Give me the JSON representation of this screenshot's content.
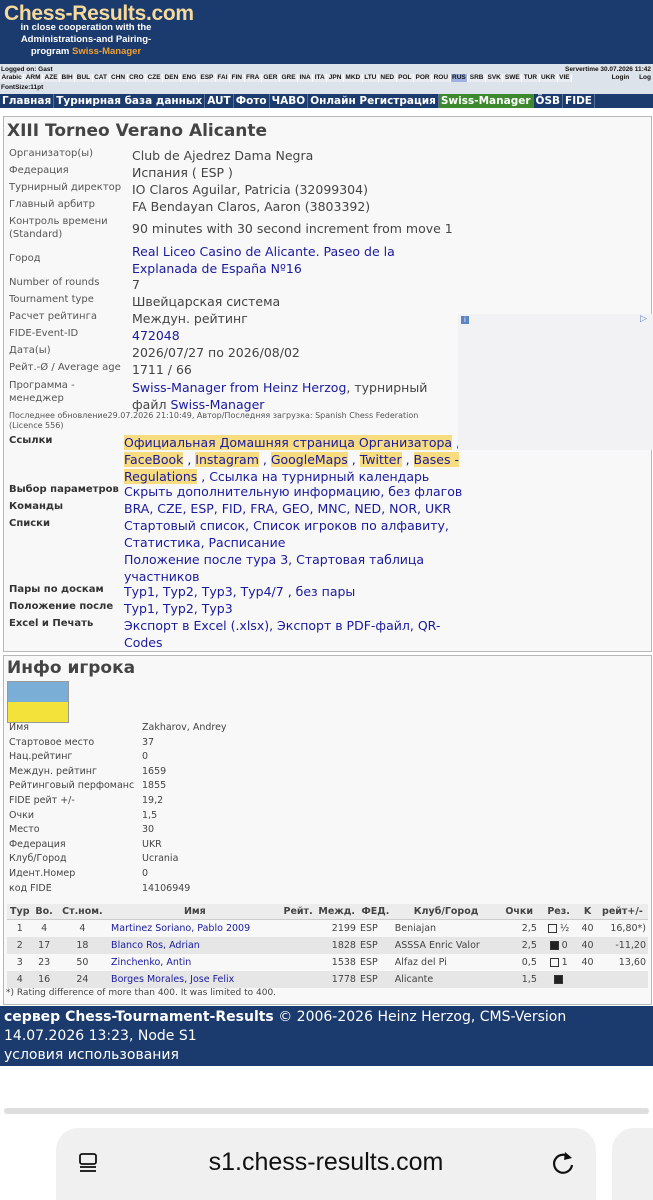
{
  "header": {
    "brand": "Chess-Results.com",
    "tagline_lines": [
      "in close cooperation with the",
      "Administrations-and Pairing-"
    ],
    "tagline_prefix": "program ",
    "tagline_highlight": "Swiss-Manager"
  },
  "status": {
    "logged_on": "Logged on: Gast",
    "servertime": "Servertime 30.07.2026 11:42",
    "languages": [
      "Arabic",
      "ARM",
      "AZE",
      "BIH",
      "BUL",
      "CAT",
      "CHN",
      "CRO",
      "CZE",
      "DEN",
      "ENG",
      "ESP",
      "FAI",
      "FIN",
      "FRA",
      "GER",
      "GRE",
      "INA",
      "ITA",
      "JPN",
      "MKD",
      "LTU",
      "NED",
      "POL",
      "POR",
      "ROU",
      "RUS",
      "SRB",
      "SVK",
      "SWE",
      "TUR",
      "UKR",
      "VIE"
    ],
    "active_language": "RUS",
    "login": "Login",
    "log": "Log",
    "fontsize": "FontSize:11pt"
  },
  "nav": [
    "Главная",
    "Турнирная база данных",
    "AUT",
    "Фото",
    "ЧАВО",
    "Онлайн Регистрация",
    "Swiss-Manager",
    "ÖSB",
    "FIDE"
  ],
  "tournament": {
    "title": "XIII Torneo Verano Alicante",
    "organizer_label": "Организатор(ы)",
    "organizer": "Club de Ajedrez Dama Negra",
    "federation_label": "Федерация",
    "federation": "Испания ( ESP )",
    "director_label": "Турнирный директор",
    "director": "IO Claros Aguilar, Patricia (32099304)",
    "arbiter_label": "Главный арбитр",
    "arbiter": "FA Bendayan Claros, Aaron (3803392)",
    "time_label_1": "Контроль времени",
    "time_label_2": "(Standard)",
    "time_control": "90 minutes with 30 second increment from move 1",
    "city_label": "Город",
    "city": "Real Liceo Casino de Alicante. Paseo de la Explanada de España Nº16",
    "rounds_label": "Number of rounds",
    "rounds": "7",
    "type_label": "Tournament type",
    "type": "Швейцарская система",
    "rating_label": "Расчет рейтинга",
    "rating": "Междун. рейтинг",
    "fide_event_label": "FIDE-Event-ID",
    "fide_event": "472048",
    "dates_label": "Дата(ы)",
    "dates": "2026/07/27 по 2026/08/02",
    "avg_label": "Рейт.-Ø / Average age",
    "avg": "1711 / 66",
    "program_label_1": "Программа -",
    "program_label_2": "менеджер",
    "program_link1": "Swiss-Manager from Heinz Herzog",
    "program_sep": ", турнирный файл ",
    "program_link2": "Swiss-Manager",
    "updated": "Последнее обновление29.07.2026 21:10:49, Автор/Последняя загрузка: Spanish Chess Federation (Licence 556)",
    "links_label": "Ссылки",
    "link_home": "Официальная Домашняя страница Организатора",
    "link_facebook": "FaceBook",
    "link_instagram": "Instagram",
    "link_maps": "GoogleMaps",
    "link_twitter": "Twitter",
    "link_bases": "Bases - Regulations",
    "link_calendar": "Ссылка на турнирный календарь",
    "params_label": "Выбор параметров",
    "params_hide": "Скрыть дополнительную информацию",
    "params_noflags": "без флагов",
    "teams_label": "Команды",
    "teams": [
      "BRA",
      "CZE",
      "ESP",
      "FID",
      "FRA",
      "GEO",
      "MNC",
      "NED",
      "NOR",
      "UKR"
    ],
    "lists_label": "Списки",
    "list_start": "Стартовый список",
    "list_alpha": "Список игроков по алфавиту",
    "list_stats": "Статистика",
    "list_schedule": "Расписание",
    "list_after": "Положение после тура 3",
    "list_crosstable": "Стартовая таблица участников",
    "pairings_label": "Пары по доскам",
    "pairings": [
      "Тур1",
      "Тур2",
      "Тур3",
      "Тур4/7"
    ],
    "pairings_none": "без пары",
    "standings_label": "Положение после",
    "standings": [
      "Тур1",
      "Тур2",
      "Тур3"
    ],
    "excel_label": "Excel и Печать",
    "excel": "Экспорт в Excel (.xlsx)",
    "pdf": "Экспорт в PDF-файл",
    "qr": "QR-Codes"
  },
  "player": {
    "title": "Инфо игрока",
    "fields": [
      {
        "label": "Имя",
        "value": "Zakharov, Andrey"
      },
      {
        "label": "Стартовое место",
        "value": "37"
      },
      {
        "label": "Нац.рейтинг",
        "value": "0"
      },
      {
        "label": "Междун. рейтинг",
        "value": "1659"
      },
      {
        "label": "Рейтинговый перфоманс",
        "value": "1855"
      },
      {
        "label": "FIDE рейт +/-",
        "value": "19,2"
      },
      {
        "label": "Очки",
        "value": "1,5"
      },
      {
        "label": "Место",
        "value": "30"
      },
      {
        "label": "Федерация",
        "value": "UKR"
      },
      {
        "label": "Клуб/Город",
        "value": "Ucrania"
      },
      {
        "label": "Идент.Номер",
        "value": "0"
      },
      {
        "label": "код FIDE",
        "value": "14106949"
      }
    ],
    "flag_colors": {
      "top": "#7aaed6",
      "bottom": "#f3e23a"
    },
    "games_headers": [
      "Тур",
      "Во.",
      "Ст.ном.",
      "Имя",
      "Рейт.",
      "Межд.",
      "ФЕД.",
      "Клуб/Город",
      "Очки",
      "Рез.",
      "K",
      "рейт+/-"
    ],
    "games": [
      {
        "round": "1",
        "board": "4",
        "start": "4",
        "name": "Martinez Soriano, Pablo",
        "rating": "2009",
        "intl": "2199",
        "fed": "ESP",
        "club": "Beniajan",
        "points": "2,5",
        "color": "white",
        "result": "½",
        "k": "40",
        "diff": "16,80*)"
      },
      {
        "round": "2",
        "board": "17",
        "start": "18",
        "name": "Blanco Ros, Adrian",
        "rating": "",
        "intl": "1828",
        "fed": "ESP",
        "club": "ASSSA Enric Valor",
        "points": "2,5",
        "color": "black",
        "result": "0",
        "k": "40",
        "diff": "-11,20"
      },
      {
        "round": "3",
        "board": "23",
        "start": "50",
        "name": "Zinchenko, Antin",
        "rating": "",
        "intl": "1538",
        "fed": "ESP",
        "club": "Alfaz del Pi",
        "points": "0,5",
        "color": "white",
        "result": "1",
        "k": "40",
        "diff": "13,60"
      },
      {
        "round": "4",
        "board": "16",
        "start": "24",
        "name": "Borges Morales, Jose Felix",
        "rating": "",
        "intl": "1778",
        "fed": "ESP",
        "club": "Alicante",
        "points": "1,5",
        "color": "black",
        "result": "",
        "k": "",
        "diff": ""
      }
    ],
    "note": "*) Rating difference of more than 400. It was limited to 400."
  },
  "footer": {
    "server": "сервер Chess-Tournament-Results",
    "copyright": " © 2006-2026 Heinz Herzog, CMS-Version 14.07.2026 13:23, Node S1",
    "terms": "условия использования"
  },
  "browser": {
    "url": "s1.chess-results.com",
    "menu_icon": "menu-icon",
    "reload_icon": "reload-icon"
  }
}
